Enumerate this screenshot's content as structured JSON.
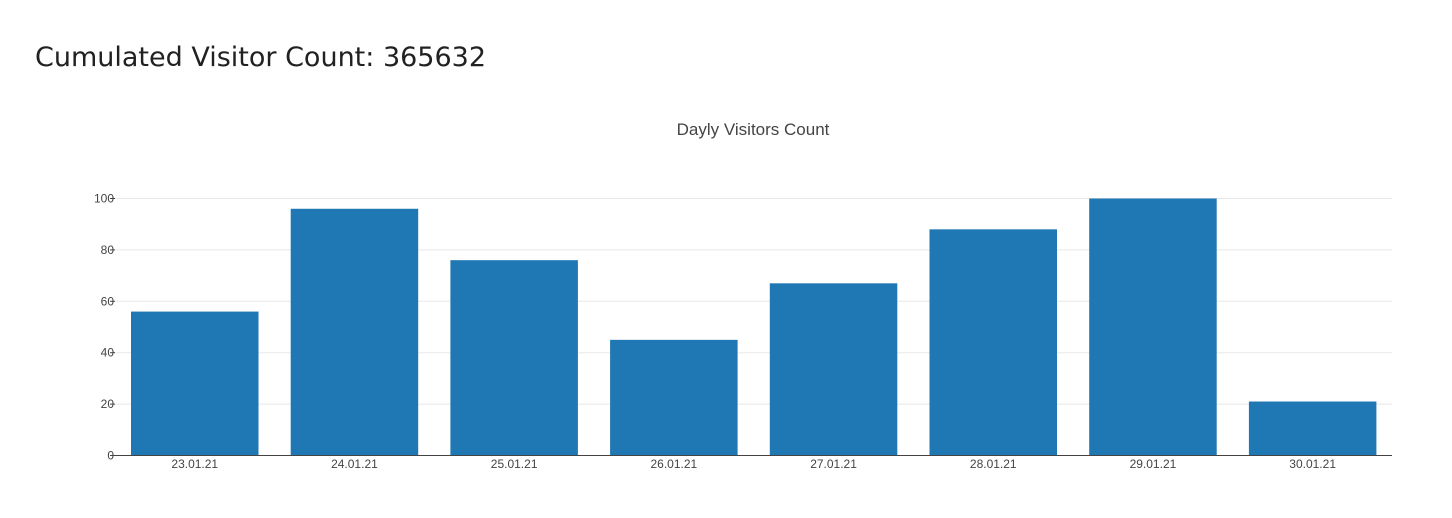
{
  "page": {
    "heading_prefix": "Cumulated Visitor Count:",
    "cumulated_count": "365632"
  },
  "chart_data": {
    "type": "bar",
    "title": "Dayly Visitors Count",
    "xlabel": "",
    "ylabel": "",
    "categories": [
      "23.01.21",
      "24.01.21",
      "25.01.21",
      "26.01.21",
      "27.01.21",
      "28.01.21",
      "29.01.21",
      "30.01.21"
    ],
    "values": [
      56,
      96,
      76,
      45,
      67,
      88,
      100,
      21
    ],
    "ylim": [
      0,
      100
    ],
    "yticks": [
      0,
      20,
      40,
      60,
      80,
      100
    ],
    "grid": true,
    "legend": "none",
    "bar_color": "#1f77b4"
  }
}
